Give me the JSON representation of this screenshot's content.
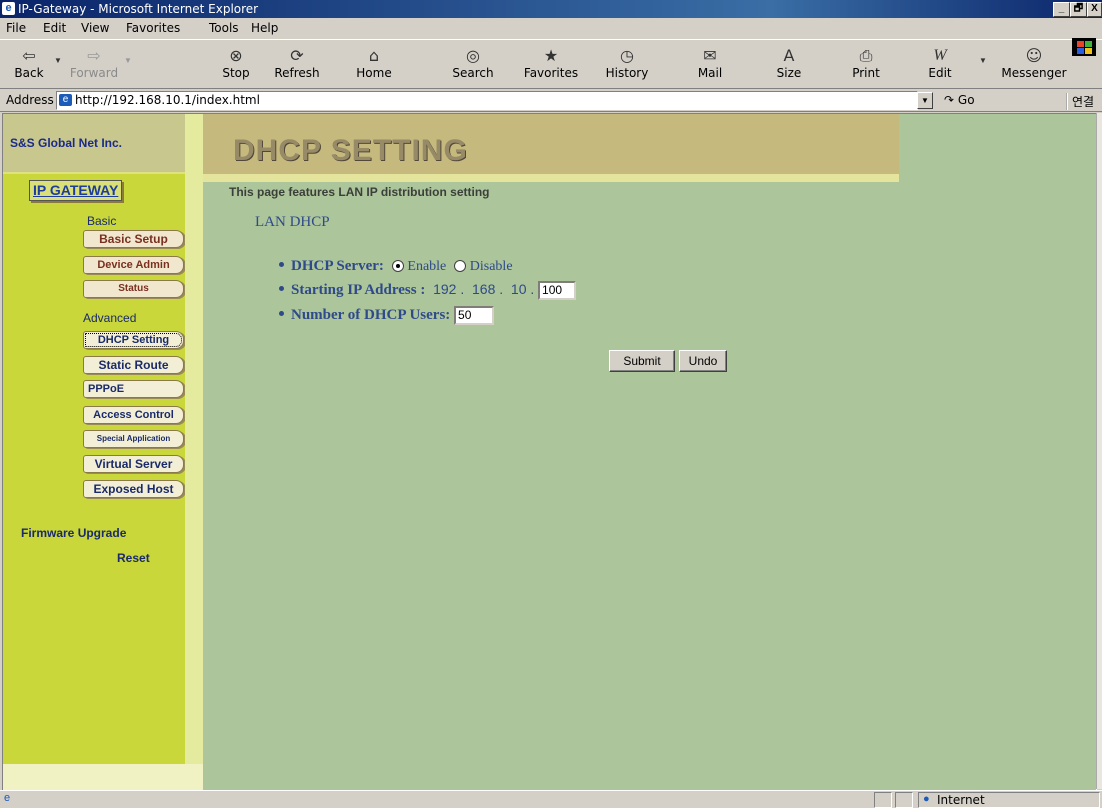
{
  "window": {
    "title": "IP-Gateway - Microsoft Internet Explorer",
    "controls": [
      "_",
      "🗗",
      "X"
    ]
  },
  "menu": [
    "File",
    "Edit",
    "View",
    "Favorites",
    "Tools",
    "Help"
  ],
  "toolbar": {
    "back": "Back",
    "forward": "Forward",
    "stop": "Stop",
    "refresh": "Refresh",
    "home": "Home",
    "search": "Search",
    "favorites": "Favorites",
    "history": "History",
    "mail": "Mail",
    "size": "Size",
    "print": "Print",
    "edit": "Edit",
    "messenger": "Messenger"
  },
  "address": {
    "label": "Address",
    "url": "http://192.168.10.1/index.html",
    "go": "Go",
    "links": "연결"
  },
  "sidebar": {
    "company": "S&S Global Net Inc.",
    "product": "IP GATEWAY",
    "basic_label": "Basic",
    "basic_items": [
      "Basic Setup",
      "Device Admin",
      "Status"
    ],
    "advanced_label": "Advanced",
    "advanced_items": [
      "DHCP Setting",
      "Static Route",
      "PPPoE",
      "Access Control",
      "Special Application",
      "Virtual Server",
      "Exposed Host"
    ],
    "firmware": "Firmware Upgrade",
    "reset": "Reset"
  },
  "page": {
    "title": "DHCP SETTING",
    "description": "This page features LAN IP distribution setting",
    "section": "LAN DHCP",
    "dhcp_server_label": "DHCP Server:",
    "enable": "Enable",
    "disable": "Disable",
    "dhcp_enabled": true,
    "start_ip_label": "Starting IP Address :",
    "ip_prefix": "192 .  168 .  10 .",
    "start_ip_last": "100",
    "users_label": "Number of DHCP Users:",
    "users_value": "50",
    "submit": "Submit",
    "undo": "Undo"
  },
  "status": {
    "zone": "Internet"
  }
}
